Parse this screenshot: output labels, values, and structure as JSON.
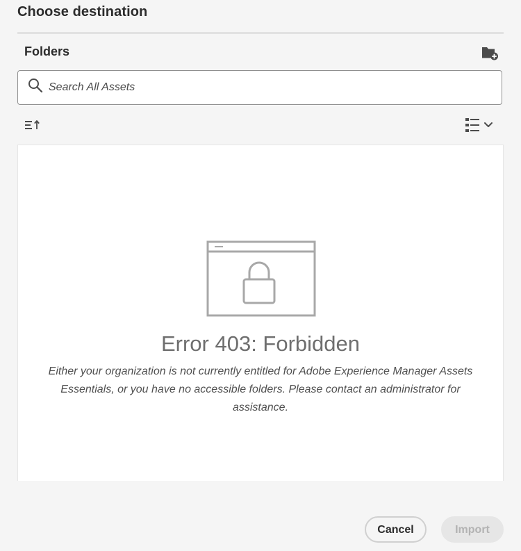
{
  "dialog": {
    "title": "Choose destination"
  },
  "folders": {
    "header": "Folders",
    "new_folder_icon": "folder-add-icon"
  },
  "search": {
    "placeholder": "Search All Assets",
    "value": "",
    "icon": "search-icon"
  },
  "toolbar": {
    "sort_icon": "sort-ascending-icon",
    "view_icon": "list-view-icon",
    "view_dropdown_icon": "chevron-down-icon"
  },
  "error": {
    "illustration_icon": "browser-lock-icon",
    "title": "Error 403: Forbidden",
    "message": "Either your organization is not currently entitled for Adobe Experience Manager Assets Essentials, or you have no accessible folders. Please contact an administrator for assistance."
  },
  "footer": {
    "cancel_label": "Cancel",
    "import_label": "Import",
    "import_disabled": true
  },
  "colors": {
    "background": "#f5f5f5",
    "panel": "#ffffff",
    "text_primary": "#2c2c2c",
    "error_text": "#6e6e6e",
    "disabled_button": "#e6e6e6",
    "disabled_text": "#b3b3b3"
  }
}
